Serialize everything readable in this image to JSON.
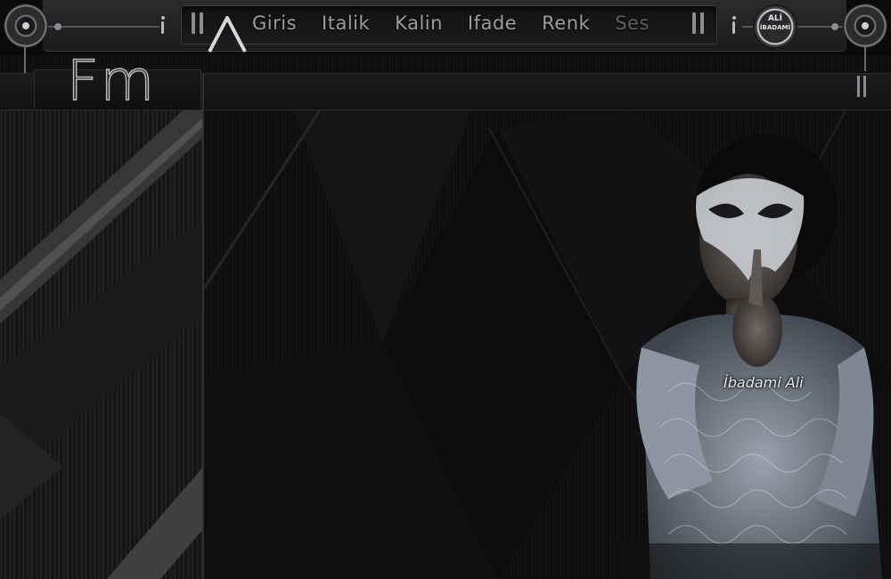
{
  "toolbar": {
    "logo_letter": "A",
    "menu": [
      {
        "label": "Giris"
      },
      {
        "label": "Italik"
      },
      {
        "label": "Kalin"
      },
      {
        "label": "Ifade"
      },
      {
        "label": "Renk"
      },
      {
        "label": "Ses"
      }
    ],
    "badge": {
      "line1": "ALİ",
      "line2": "İBADAMİ"
    }
  },
  "sidebar": {
    "logo_text": "Fm"
  },
  "content": {
    "signature": "İbadami Ali"
  },
  "colors": {
    "background": "#0e0e0f",
    "chrome": "#2b2b2e",
    "text": "#9c9ca1",
    "accent": "#bdbdc2"
  }
}
